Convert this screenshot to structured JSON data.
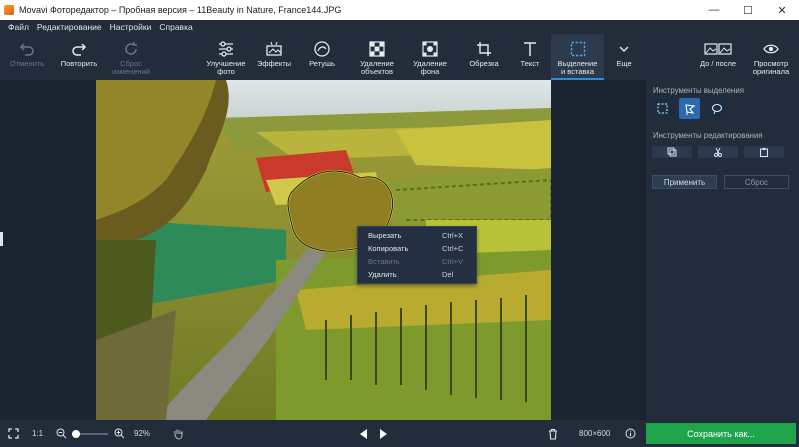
{
  "window": {
    "title": "Movavi Фоторедактор – Пробная версия – 11Beauty in Nature, France144.JPG",
    "controls": {
      "minimize": "—",
      "maximize": "☐",
      "close": "✕"
    }
  },
  "menu": [
    "Файл",
    "Редактирование",
    "Настройки",
    "Справка"
  ],
  "toolbar": {
    "undo": "Отменить",
    "redo": "Повторить",
    "reset_line1": "Сброс",
    "reset_line2": "изменений",
    "enhance_line1": "Улучшение",
    "enhance_line2": "фото",
    "effects": "Эффекты",
    "retouch": "Ретушь",
    "remove_objects_line1": "Удаление",
    "remove_objects_line2": "объектов",
    "remove_bg_line1": "Удаление",
    "remove_bg_line2": "фона",
    "crop": "Обрезка",
    "text": "Текст",
    "select_line1": "Выделение",
    "select_line2": "и вставка",
    "more": "Еще",
    "before_after": "До / после",
    "preview_line1": "Просмотр",
    "preview_line2": "оригинала"
  },
  "panel": {
    "selection_tools_label": "Инструменты выделения",
    "edit_tools_label": "Инструменты редактирования",
    "apply": "Применить",
    "reset": "Сброс"
  },
  "context_menu": [
    {
      "label": "Вырезать",
      "shortcut": "Ctrl+X",
      "disabled": false
    },
    {
      "label": "Копировать",
      "shortcut": "Ctrl+C",
      "disabled": false
    },
    {
      "label": "Вставить",
      "shortcut": "Ctrl+V",
      "disabled": true
    },
    {
      "label": "Удалить",
      "shortcut": "Del",
      "disabled": false
    }
  ],
  "status": {
    "ratio": "1:1",
    "zoom": "92%",
    "zoom_level": 0.1,
    "dimensions": "800×600",
    "save": "Сохранить как..."
  },
  "colors": {
    "accent": "#2b8fd8",
    "save": "#1fa44b",
    "background": "#1b2431",
    "panel": "#222c3a"
  }
}
